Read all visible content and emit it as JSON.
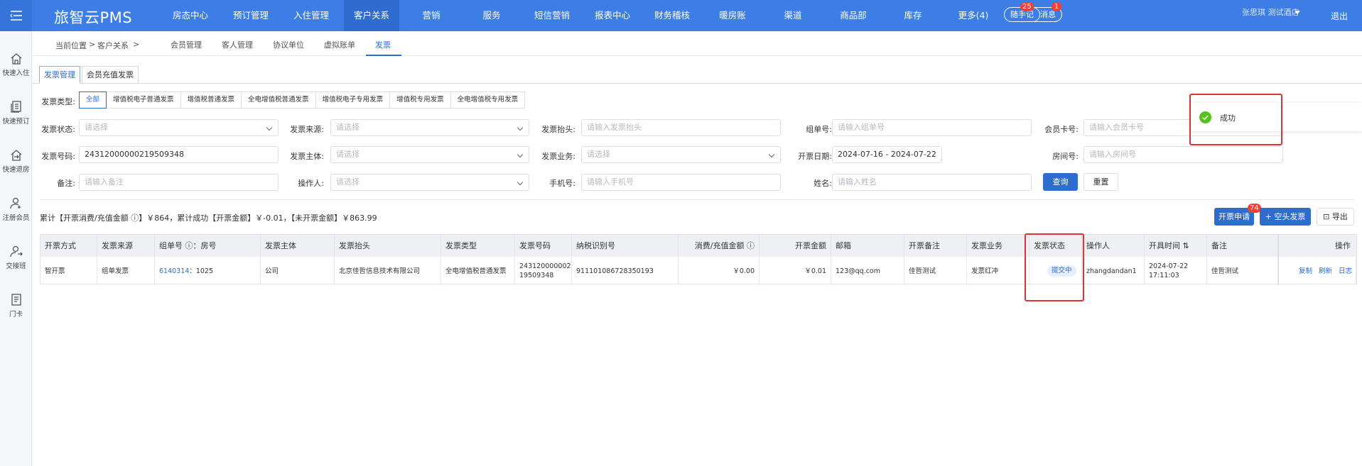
{
  "app": {
    "title": "旅智云PMS",
    "logout": "退出",
    "user": "张思琪 测试酒店"
  },
  "nav": {
    "items": [
      "房态中心",
      "预订管理",
      "入住管理",
      "客户关系",
      "营销",
      "服务",
      "短信营销",
      "报表中心",
      "财务稽核",
      "暖房账",
      "渠道",
      "商品部",
      "库存",
      "更多(4)"
    ],
    "active": "客户关系",
    "notes": {
      "label": "随手记",
      "count": "25"
    },
    "messages": {
      "label": "消息",
      "count": "1"
    }
  },
  "sidebar": {
    "items": [
      "快速入住",
      "快速预订",
      "快速退房",
      "注册会员",
      "交接班",
      "门卡"
    ]
  },
  "breadcrumb": {
    "prefix": "当前位置",
    "sep": ">",
    "current": "客户关系"
  },
  "subnav": {
    "items": [
      "会员管理",
      "客人管理",
      "协议单位",
      "虚拟账单",
      "发票"
    ],
    "active": "发票"
  },
  "tabs": {
    "items": [
      "发票管理",
      "会员充值发票"
    ],
    "active": "发票管理"
  },
  "filters": {
    "type_label": "发票类型:",
    "type_options": [
      "全部",
      "增值税电子普通发票",
      "增值税普通发票",
      "全电增值税普通发票",
      "增值税电子专用发票",
      "增值税专用发票",
      "全电增值税专用发票"
    ],
    "type_selected": "全部",
    "status": {
      "label": "发票状态:",
      "placeholder": "请选择"
    },
    "source": {
      "label": "发票来源:",
      "placeholder": "请选择"
    },
    "title": {
      "label": "发票抬头:",
      "placeholder": "请输入发票抬头"
    },
    "group_no": {
      "label": "组单号:",
      "placeholder": "请输入组单号"
    },
    "member_card": {
      "label": "会员卡号:",
      "placeholder": "请输入会员卡号"
    },
    "invoice_no": {
      "label": "发票号码:",
      "value": "24312000000219509348"
    },
    "entity": {
      "label": "发票主体:",
      "placeholder": "请选择"
    },
    "business": {
      "label": "发票业务:",
      "placeholder": "请选择"
    },
    "date": {
      "label": "开票日期:",
      "value": "2024-07-16 - 2024-07-22"
    },
    "room": {
      "label": "房间号:",
      "placeholder": "请输入房间号"
    },
    "remark": {
      "label": "备注:",
      "placeholder": "请输入备注"
    },
    "operator": {
      "label": "操作人:",
      "placeholder": "请选择"
    },
    "phone": {
      "label": "手机号:",
      "placeholder": "请输入手机号"
    },
    "name": {
      "label": "姓名:",
      "placeholder": "请输入姓名"
    },
    "query_btn": "查询",
    "reset_btn": "重置"
  },
  "summary": "累计【开票消费/充值金额 ⓘ】￥864，累计成功【开票金额】￥-0.01，【未开票金额】￥863.99",
  "actions": {
    "apply": "开票申请",
    "apply_badge": "74",
    "blank": "+ 空头发票",
    "export": "导出"
  },
  "table": {
    "headers": [
      "开票方式",
      "发票来源",
      "组单号 ⓘ：房号",
      "发票主体",
      "发票抬头",
      "发票类型",
      "发票号码",
      "纳税识别号",
      "消费/充值金额 ⓘ",
      "开票金额",
      "邮箱",
      "开票备注",
      "发票业务",
      "发票状态",
      "操作人",
      "开具时间 ⇅",
      "备注",
      "操作"
    ],
    "row": {
      "method": "智开票",
      "source": "组单发票",
      "group_no": "6140314",
      "room": "：1025",
      "entity": "公司",
      "title": "北京佳哲信息技术有限公司",
      "type": "全电增值税普通发票",
      "invoice_no_1": "243120000002",
      "invoice_no_2": "19509348",
      "tax_id": "91110108672835019З",
      "amount": "￥0.00",
      "invoice_amount": "￥0.01",
      "email": "123@qq.com",
      "invoice_remark": "佳哲测试",
      "business": "发票红冲",
      "status": "提交中",
      "operator": "zhangdandan1",
      "time_1": "2024-07-22",
      "time_2": "17:11:03",
      "remark": "佳哲测试",
      "op_copy": "复制",
      "op_refresh": "刷新",
      "op_log": "日志"
    }
  },
  "toast": {
    "text": "成功"
  },
  "colors": {
    "primary": "#2f6cd0",
    "topbar": "#3d7ee6",
    "highlight": "#e23232",
    "success": "#52c41a"
  }
}
